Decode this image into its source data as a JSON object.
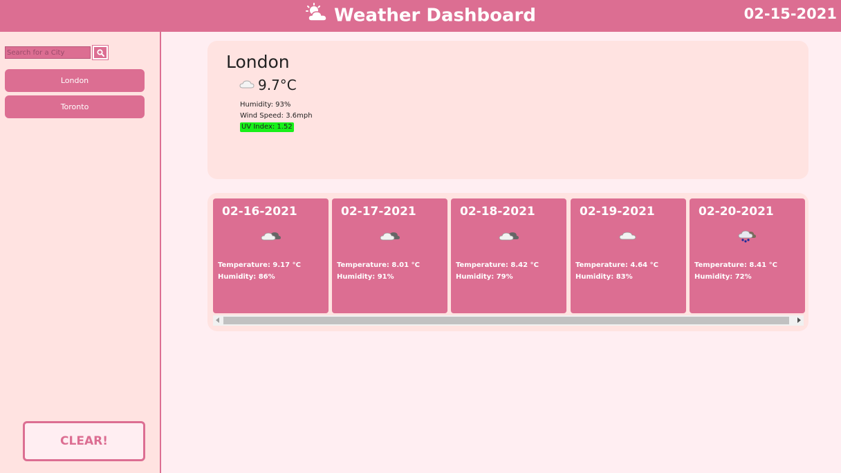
{
  "header": {
    "title": "Weather Dashboard",
    "logo_icon": "sun-cloud-icon",
    "date": "02-15-2021"
  },
  "sidebar": {
    "search_placeholder": "Search for a City",
    "search_icon": "search-icon",
    "cities": [
      {
        "label": "London"
      },
      {
        "label": "Toronto"
      }
    ],
    "clear_label": "CLEAR!"
  },
  "current": {
    "city": "London",
    "icon": "cloud-icon",
    "temp": "9.7°C",
    "humidity": "Humidity: 93%",
    "wind": "Wind Speed: 3.6mph",
    "uv": "UV Index: 1.52",
    "uv_color": "#19f019"
  },
  "forecast": [
    {
      "date": "02-16-2021",
      "icon": "partly-cloudy-icon",
      "temp": "Temperature: 9.17 °C",
      "humidity": "Humidity: 86%"
    },
    {
      "date": "02-17-2021",
      "icon": "partly-cloudy-icon",
      "temp": "Temperature: 8.01 °C",
      "humidity": "Humidity: 91%"
    },
    {
      "date": "02-18-2021",
      "icon": "partly-cloudy-icon",
      "temp": "Temperature: 8.42 °C",
      "humidity": "Humidity: 79%"
    },
    {
      "date": "02-19-2021",
      "icon": "cloud-icon",
      "temp": "Temperature: 4.64 °C",
      "humidity": "Humidity: 83%"
    },
    {
      "date": "02-20-2021",
      "icon": "rain-icon",
      "temp": "Temperature: 8.41 °C",
      "humidity": "Humidity: 72%"
    }
  ],
  "colors": {
    "accent": "#dc6e92",
    "panel": "#ffe3e1",
    "background": "#ffeef2"
  }
}
